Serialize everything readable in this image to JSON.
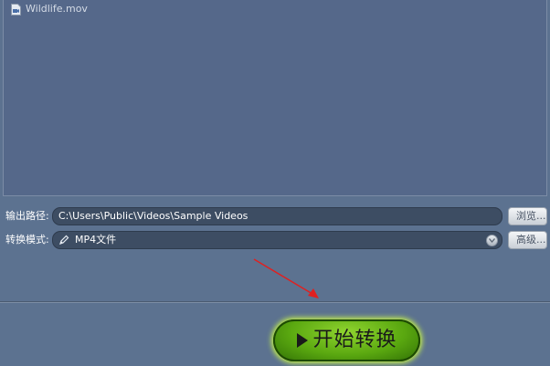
{
  "file_list": {
    "items": [
      {
        "name": "Wildlife.mov",
        "icon": "video-file-icon"
      }
    ]
  },
  "output": {
    "label": "输出路径:",
    "path": "C:\\Users\\Public\\Videos\\Sample Videos",
    "browse_label": "浏览..."
  },
  "mode": {
    "label": "转换模式:",
    "value": "MP4文件",
    "icon": "pencil-icon",
    "advanced_label": "高级..."
  },
  "start": {
    "label": "开始转换",
    "icon": "play-icon"
  },
  "colors": {
    "background": "#5c7290",
    "start_button": "#5aa810",
    "annotation_arrow": "#e02020"
  }
}
